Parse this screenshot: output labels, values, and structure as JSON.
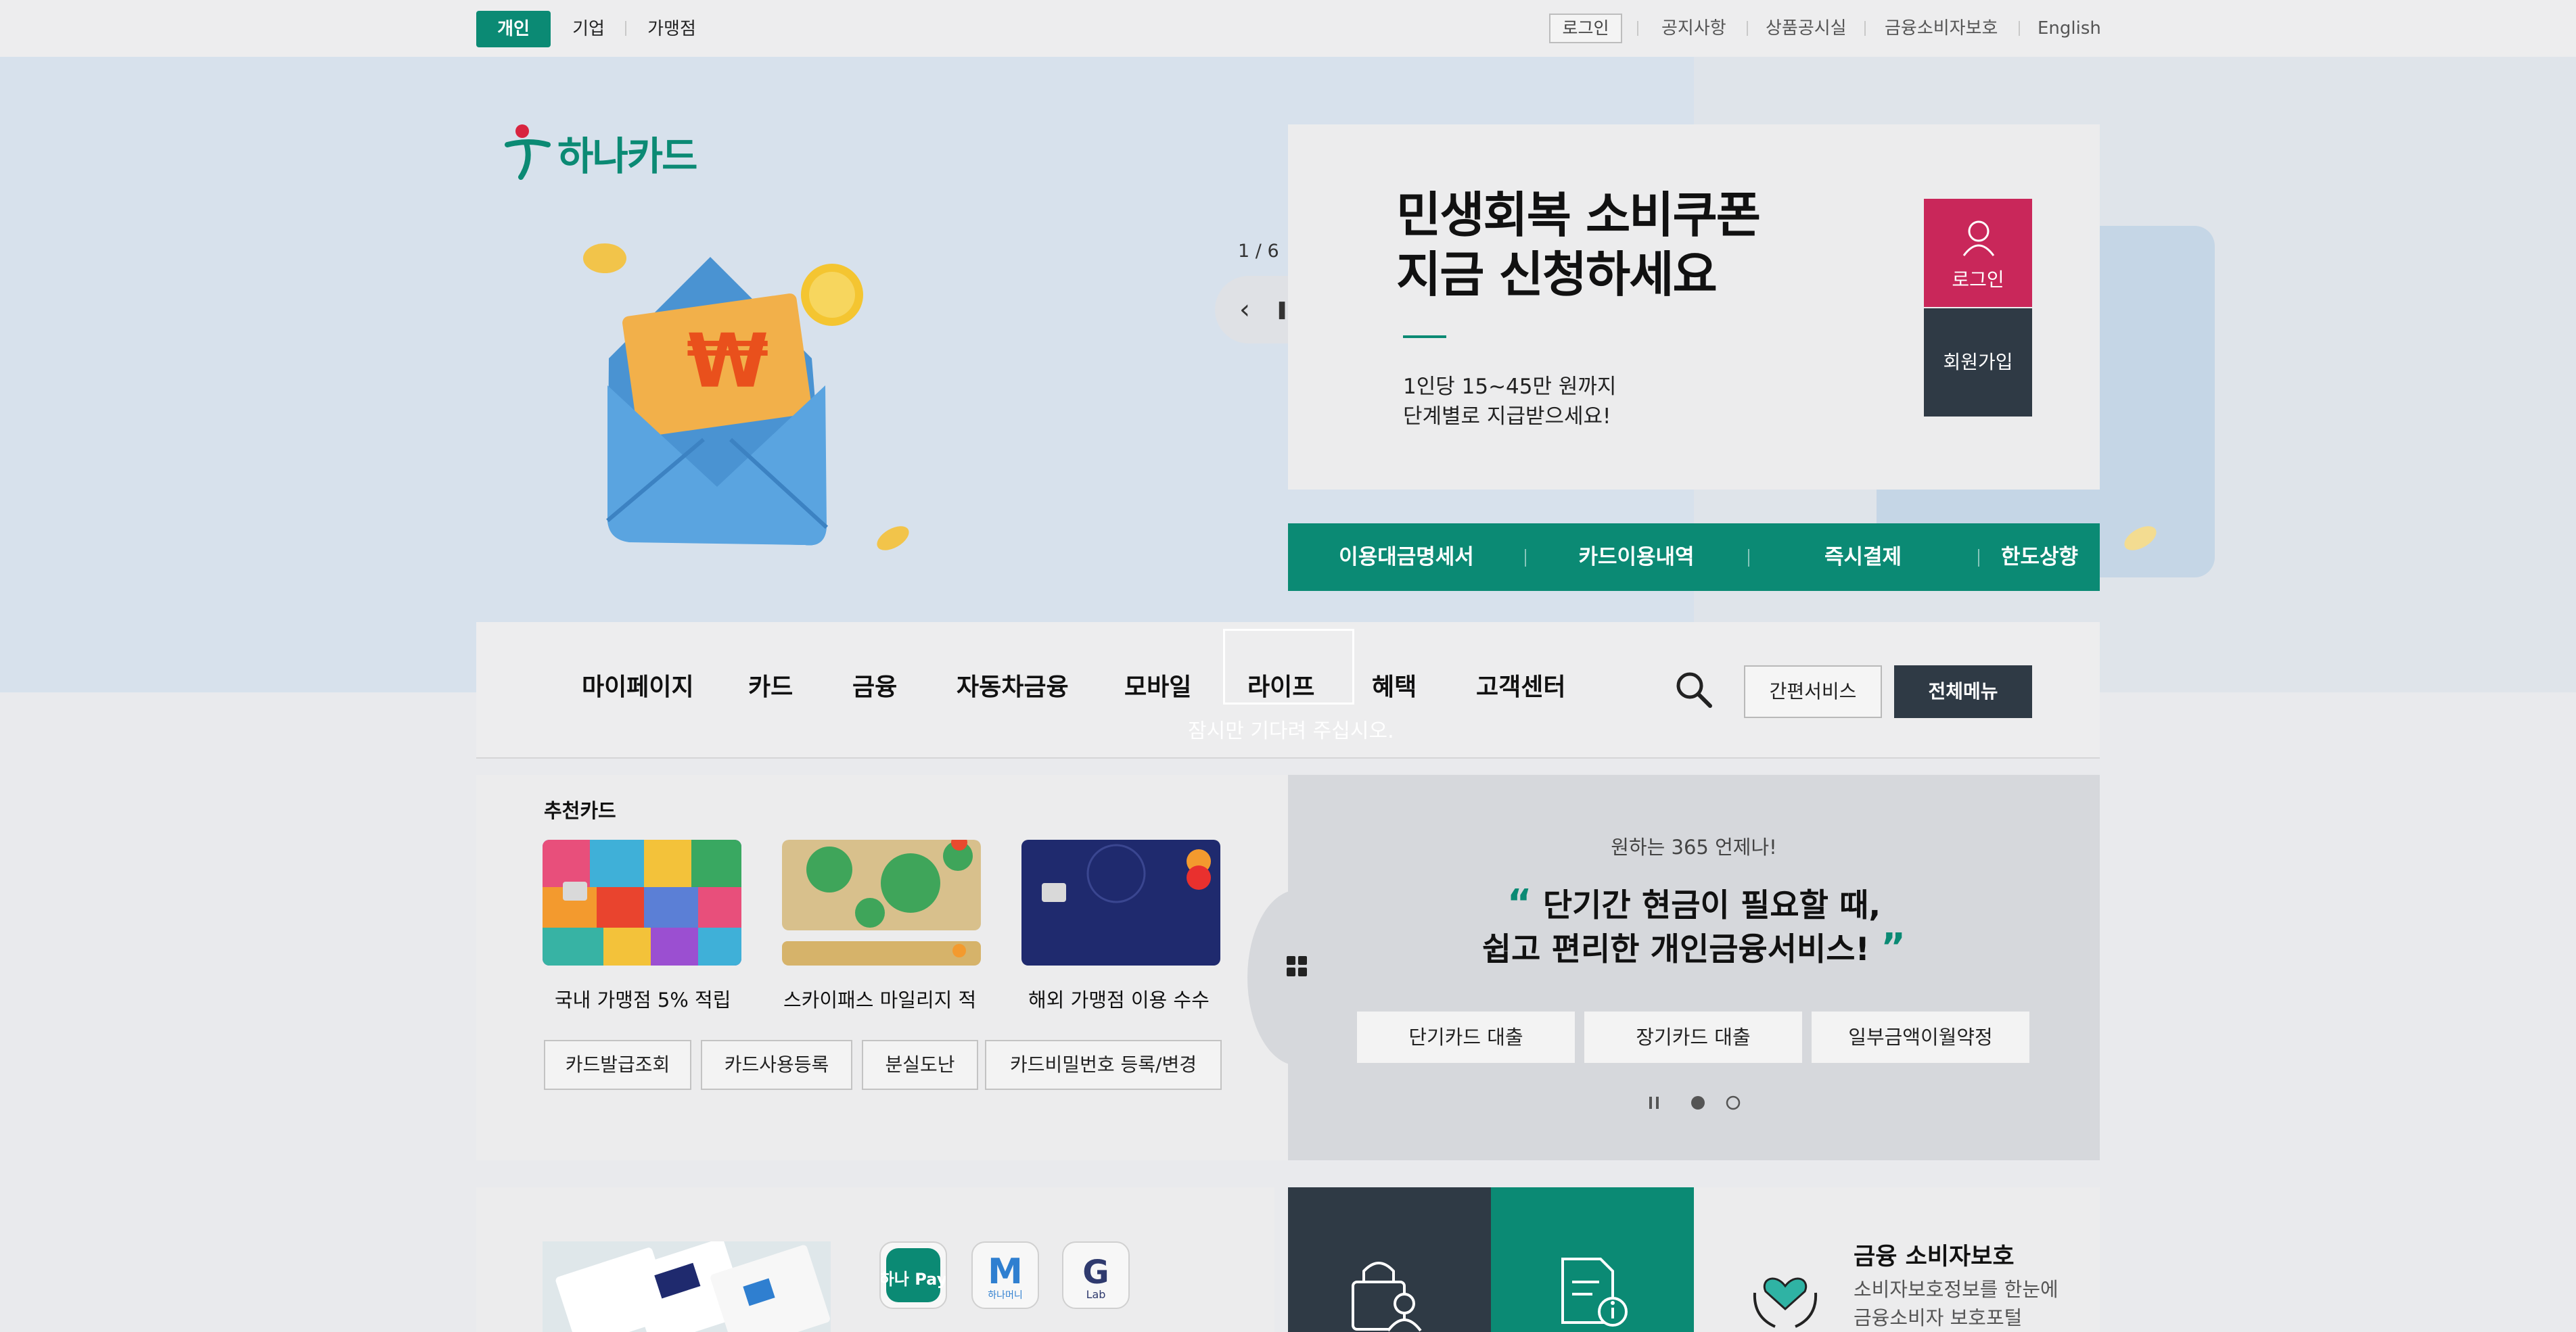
{
  "colors": {
    "brand_green": "#0b8a74",
    "login_red": "#c9275a",
    "dark_navy": "#2f3a45"
  },
  "topbar": {
    "segments": [
      "개인",
      "기업",
      "가맹점"
    ],
    "login": "로그인",
    "links": [
      "공지사항",
      "상품공시실",
      "금융소비자보호",
      "English"
    ]
  },
  "brand": {
    "logo_text": "하나카드"
  },
  "hero": {
    "counter": "1 / 6",
    "controls": {
      "prev": "‹",
      "pause": "❚❚",
      "next": "›"
    },
    "title_lines": [
      "민생회복 소비쿠폰",
      "지금 신청하세요"
    ],
    "desc_lines": [
      "1인당 15~45만 원까지",
      "단계별로 지급받으세요!"
    ],
    "login_label": "로그인",
    "join_label": "회원가입"
  },
  "quickbar": [
    "이용대금명세서",
    "카드이용내역",
    "즉시결제",
    "한도상향"
  ],
  "gnb": {
    "items": [
      "마이페이지",
      "카드",
      "금융",
      "자동차금융",
      "모바일",
      "라이프",
      "혜택",
      "고객센터"
    ],
    "loading": "잠시만 기다려 주십시오.",
    "easy_service": "간편서비스",
    "all_menu": "전체메뉴"
  },
  "recommend": {
    "title": "추천카드",
    "cards": [
      "국내 가맹점 5% 적립",
      "스카이패스 마일리지 적",
      "해외 가맹점 이용 수수"
    ],
    "buttons": [
      "카드발급조회",
      "카드사용등록",
      "분실도난",
      "카드비밀번호 등록/변경"
    ]
  },
  "loan": {
    "subtitle": "원하는 365 언제나!",
    "title_lines": [
      "단기간 현금이 필요할 때,",
      "쉽고 편리한 개인금융서비스!"
    ],
    "buttons": [
      "단기카드 대출",
      "장기카드 대출",
      "일부금액이월약정"
    ]
  },
  "apps": [
    {
      "name": "hana-pay",
      "label": "하나 Pay"
    },
    {
      "name": "hana-money",
      "label": "하나머니"
    },
    {
      "name": "g-lab",
      "label": "Lab"
    }
  ],
  "consumer": {
    "title": "금융 소비자보호",
    "desc_lines": [
      "소비자보호정보를 한눈에",
      "금융소비자 보호포털"
    ]
  }
}
